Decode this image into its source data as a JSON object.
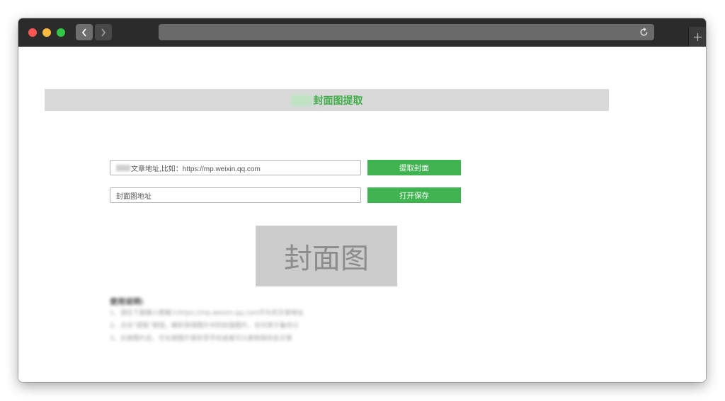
{
  "browser": {
    "traffic_lights": [
      "close",
      "minimize",
      "zoom"
    ],
    "nav": {
      "back": "back-arrow",
      "forward": "forward-arrow"
    },
    "address_text": "",
    "new_tab_label": "+"
  },
  "page": {
    "banner_title": "封面图提取",
    "url_input": {
      "value": "",
      "placeholder": "文章地址,比如：https://mp.weixin.qq.com"
    },
    "extract_button": "提取封面",
    "cover_input": {
      "value": "",
      "placeholder": "封面图地址"
    },
    "save_button": "打开保存",
    "cover_placeholder": "封面图",
    "instructions": {
      "title": "使用说明:",
      "items": [
        "1、请在下面输入框输入https://mp.weixin.qq.com开头的文章地址",
        "2、点击“提取”按钮，解析获得图片中的封面图片，也可用于备份以",
        "3、长按图片后，可长按图片保存至手机或者可以复制保存此文章"
      ]
    }
  },
  "colors": {
    "accent_green": "#3fb34f",
    "title_green": "#3fae49",
    "titlebar": "#2b2b2b",
    "banner_bg": "#d9d9d9",
    "cover_bg": "#cccccc"
  }
}
